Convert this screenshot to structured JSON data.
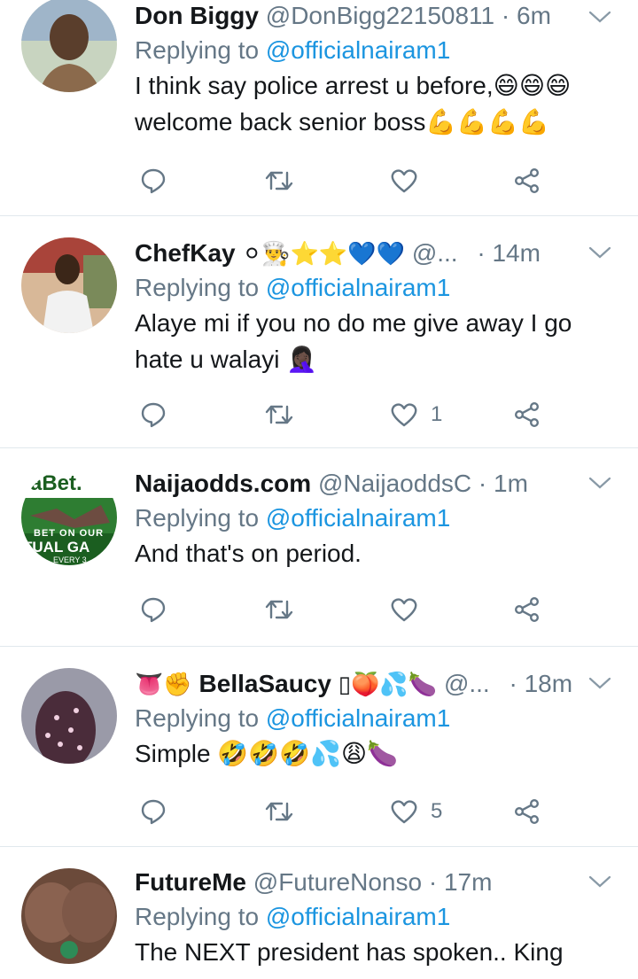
{
  "tweets": [
    {
      "name": "Don Biggy",
      "handle": "@DonBigg22150811",
      "time": "· 6m",
      "reply_prefix": "Replying to",
      "reply_to": "@officialnairam1",
      "text_lines": [
        "I think say police arrest u before,😄😄😄",
        "welcome back senior boss💪💪💪💪"
      ],
      "like_count": "",
      "avatar_colors": [
        "#b7c7b0",
        "#4a3a2c"
      ]
    },
    {
      "name": "ChefKay",
      "name_emoji": "⚪👨‍🍳⭐⭐💙💙",
      "handle": "@...",
      "time": "· 14m",
      "reply_prefix": "Replying to",
      "reply_to": "@officialnairam1",
      "text_lines": [
        "Alaye mi if you no do me give away I go",
        "hate u walayi 🤦🏿‍♀️"
      ],
      "like_count": "1",
      "avatar_colors": [
        "#c9a98a",
        "#3a2a20"
      ]
    },
    {
      "name": "Naijaodds.com",
      "handle": "@NaijaoddsC",
      "time": "· 1m",
      "reply_prefix": "Replying to",
      "reply_to": "@officialnairam1",
      "text_lines": [
        "And that's on period."
      ],
      "like_count": "",
      "avatar_text_top": "aBet.",
      "avatar_text_mid": "BET ON OUR",
      "avatar_text_bot": "TUAL GA",
      "avatar_text_small": "EVERY 3"
    },
    {
      "name": "BellaSaucy",
      "name_prefix_emoji": "👅✊",
      "name_emoji": "▯🍑💦🍆",
      "handle": "@...",
      "time": "· 18m",
      "reply_prefix": "Replying to",
      "reply_to": "@officialnairam1",
      "text_lines": [
        "Simple 🤣🤣🤣💦😩🍆"
      ],
      "like_count": "5",
      "avatar_colors": [
        "#8a8a9a",
        "#5a4050"
      ]
    },
    {
      "name": "FutureMe",
      "handle": "@FutureNonso",
      "time": "· 17m",
      "reply_prefix": "Replying to",
      "reply_to": "@officialnairam1",
      "text_lines": [
        "The NEXT president has spoken.. King"
      ],
      "like_count": "",
      "avatar_colors": [
        "#7a5a48",
        "#3a2a22"
      ]
    }
  ],
  "icons": {
    "reply": "reply-icon",
    "retweet": "retweet-icon",
    "like": "heart-icon",
    "share": "share-icon",
    "more": "chevron-down-icon"
  },
  "colors": {
    "secondary_text": "#657786",
    "link": "#1b95e0",
    "divider": "#e1e8ed"
  }
}
